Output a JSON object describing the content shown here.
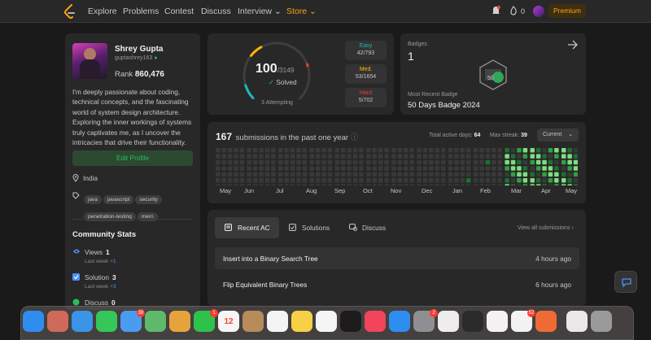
{
  "nav": {
    "items": [
      "Explore",
      "Problems",
      "Contest",
      "Discuss"
    ],
    "interview_label": "Interview",
    "store_label": "Store",
    "streak_count": "0",
    "premium_label": "Premium"
  },
  "profile": {
    "name": "Shrey Gupta",
    "username": "guptashrey163",
    "rank_label": "Rank",
    "rank_value": "860,476",
    "bio": "I'm deeply passionate about coding, technical concepts, and the fascinating world of system design architecture. Exploring the inner workings of systems truly captivates me, as I uncover the intricacies that drive their functionality.",
    "edit_button": "Edit Profile",
    "location": "India",
    "tags": [
      "java",
      "javascript",
      "security",
      "penetration-testing",
      "mern"
    ]
  },
  "community": {
    "title": "Community Stats",
    "stats": [
      {
        "label": "Views",
        "value": "1",
        "sub_label": "Last week",
        "sub_value": "+1"
      },
      {
        "label": "Solution",
        "value": "3",
        "sub_label": "Last week",
        "sub_value": "+3"
      },
      {
        "label": "Discuss",
        "value": "0"
      }
    ]
  },
  "solved": {
    "count": "100",
    "total": "/3149",
    "label": "Solved",
    "attempting": "3 Attempting",
    "difficulty": [
      {
        "name": "Easy",
        "value": "42/793",
        "color": "#1cbaba",
        "fraction": 0.053
      },
      {
        "name": "Med.",
        "value": "53/1654",
        "color": "#ffb700",
        "fraction": 0.032
      },
      {
        "name": "Hard",
        "value": "5/702",
        "color": "#f63737",
        "fraction": 0.007
      }
    ]
  },
  "badges": {
    "title": "Badges",
    "count": "1",
    "recent_label": "Most Recent Badge",
    "recent_name": "50 Days Badge 2024",
    "badge_text": "50"
  },
  "submissions": {
    "count": "167",
    "title": "submissions in the past one year",
    "active_days_label": "Total active days:",
    "active_days": "64",
    "max_streak_label": "Max streak:",
    "max_streak": "39",
    "period": "Current",
    "months": [
      "May",
      "Jun",
      "Jul",
      "Aug",
      "Sep",
      "Oct",
      "Nov",
      "Dec",
      "Jan",
      "Feb",
      "Mar",
      "Apr",
      "May"
    ],
    "colors": {
      "empty": "#393939",
      "l1": "#0e4429",
      "l2": "#1e6f32",
      "l3": "#2ea043",
      "l4": "#7fdc80"
    }
  },
  "recent": {
    "tabs": [
      "Recent AC",
      "Solutions",
      "Discuss"
    ],
    "view_all": "View all submissions",
    "rows": [
      {
        "title": "Insert into a Binary Search Tree",
        "time": "4 hours ago"
      },
      {
        "title": "Flip Equivalent Binary Trees",
        "time": "6 hours ago"
      }
    ]
  },
  "dock": {
    "apps": [
      {
        "name": "finder",
        "color": "#2f8df0"
      },
      {
        "name": "launchpad",
        "color": "#cf6a5a"
      },
      {
        "name": "safari",
        "color": "#3a94e8"
      },
      {
        "name": "messages",
        "color": "#35c759"
      },
      {
        "name": "mail",
        "color": "#4a9cf0",
        "badge": "38"
      },
      {
        "name": "maps",
        "color": "#5fb96b"
      },
      {
        "name": "photos",
        "color": "#e6a33c"
      },
      {
        "name": "facetime",
        "color": "#2ec24c",
        "badge": "1"
      },
      {
        "name": "calendar",
        "color": "#f5f5f5",
        "label": "12"
      },
      {
        "name": "contacts",
        "color": "#b78b5a"
      },
      {
        "name": "reminders",
        "color": "#f4f4f4"
      },
      {
        "name": "notes",
        "color": "#f7d046"
      },
      {
        "name": "freeform",
        "color": "#f5f5f5"
      },
      {
        "name": "tv",
        "color": "#1c1c1c"
      },
      {
        "name": "music",
        "color": "#f2455c"
      },
      {
        "name": "app-store",
        "color": "#2f8df0"
      },
      {
        "name": "system-settings",
        "color": "#8e8e93",
        "badge": "2"
      },
      {
        "name": "mongodb",
        "color": "#ededed"
      },
      {
        "name": "terminal",
        "color": "#2b2b2b"
      },
      {
        "name": "chrome",
        "color": "#f2f2f2"
      },
      {
        "name": "slack",
        "color": "#f2f2f2",
        "badge": "52"
      },
      {
        "name": "postman",
        "color": "#f06a35"
      },
      {
        "name": "document",
        "color": "#e8e8e8"
      },
      {
        "name": "trash",
        "color": "#9a9a9a"
      }
    ]
  }
}
